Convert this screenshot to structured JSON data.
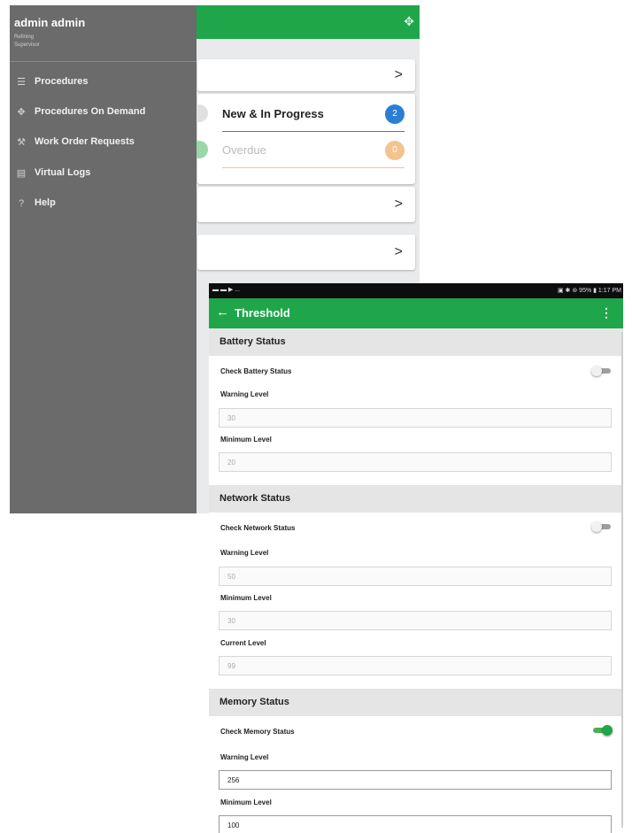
{
  "screen1": {
    "drawer": {
      "user_name": "admin admin",
      "site": "Refining",
      "role": "Supervisor",
      "items": [
        {
          "label": "Procedures",
          "icon": "list-icon"
        },
        {
          "label": "Procedures On Demand",
          "icon": "move-icon"
        },
        {
          "label": "Work Order Requests",
          "icon": "wrench-icon"
        },
        {
          "label": "Virtual Logs",
          "icon": "log-icon"
        },
        {
          "label": "Help",
          "icon": "help-icon"
        }
      ]
    },
    "status": {
      "new_in_progress_label": "New & In Progress",
      "new_in_progress_count": "2",
      "overdue_label": "Overdue",
      "overdue_count": "0"
    },
    "colors": {
      "green": "#1fa64a",
      "blue": "#2a7fd4",
      "orange": "#f3c48d"
    }
  },
  "screen2": {
    "status_bar": {
      "left": "▬ ▬ ▶ ...",
      "right": "▣ ✱ ⊚ 95% ▮ 1:17 PM"
    },
    "title": "Threshold",
    "battery": {
      "section": "Battery Status",
      "check_label": "Check Battery Status",
      "warning_label": "Warning Level",
      "warning_value": "30",
      "minimum_label": "Minimum Level",
      "minimum_value": "20"
    },
    "network": {
      "section": "Network Status",
      "check_label": "Check Network Status",
      "warning_label": "Warning Level",
      "warning_value": "50",
      "minimum_label": "Minimum Level",
      "minimum_value": "30",
      "current_label": "Current Level",
      "current_value": "99"
    },
    "memory": {
      "section": "Memory Status",
      "check_label": "Check Memory Status",
      "warning_label": "Warning Level",
      "warning_value": "256",
      "minimum_label": "Minimum Level",
      "minimum_value": "100"
    }
  }
}
